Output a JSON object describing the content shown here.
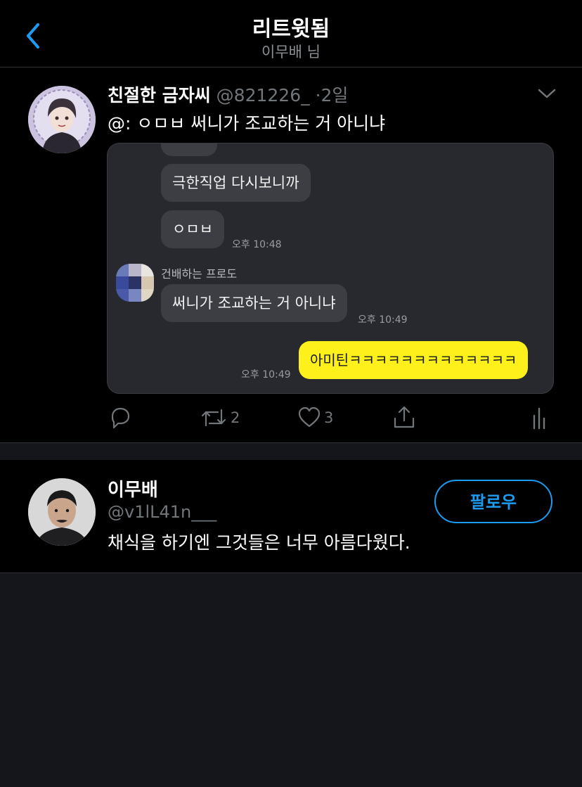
{
  "header": {
    "title": "리트윗됨",
    "subtitle": "이무배 님",
    "back_icon": "chevron-left-icon",
    "accent_color": "#1d9bf0"
  },
  "tweet": {
    "author_name": "친절한 금자씨",
    "author_handle": "@821226_",
    "separator": "·",
    "time_ago": "2일",
    "text": "@: ㅇㅁㅂ 써니가 조교하는 거 아니냐",
    "media": {
      "messages": [
        {
          "side": "left",
          "text": "극한직업 다시보니까"
        },
        {
          "side": "left",
          "text": "ㅇㅁㅂ",
          "time": "오후 10:48"
        },
        {
          "side": "left",
          "sender": "건배하는 프로도",
          "text": "써니가 조교하는 거 아니냐",
          "time": "오후 10:49"
        },
        {
          "side": "right",
          "text": "아미틴ㅋㅋㅋㅋㅋㅋㅋㅋㅋㅋㅋㅋㅋ",
          "time": "오후 10:49"
        }
      ],
      "bubble_color_self": "#fef01b"
    },
    "actions": {
      "reply_icon": "reply-icon",
      "retweet_icon": "retweet-icon",
      "retweet_count": "2",
      "like_icon": "heart-icon",
      "like_count": "3",
      "share_icon": "share-icon",
      "analytics_icon": "analytics-icon"
    }
  },
  "user_card": {
    "name": "이무배",
    "handle": "@v1lL41n___",
    "bio": "채식을 하기엔 그것들은 너무 아름다웠다.",
    "follow_label": "팔로우"
  }
}
